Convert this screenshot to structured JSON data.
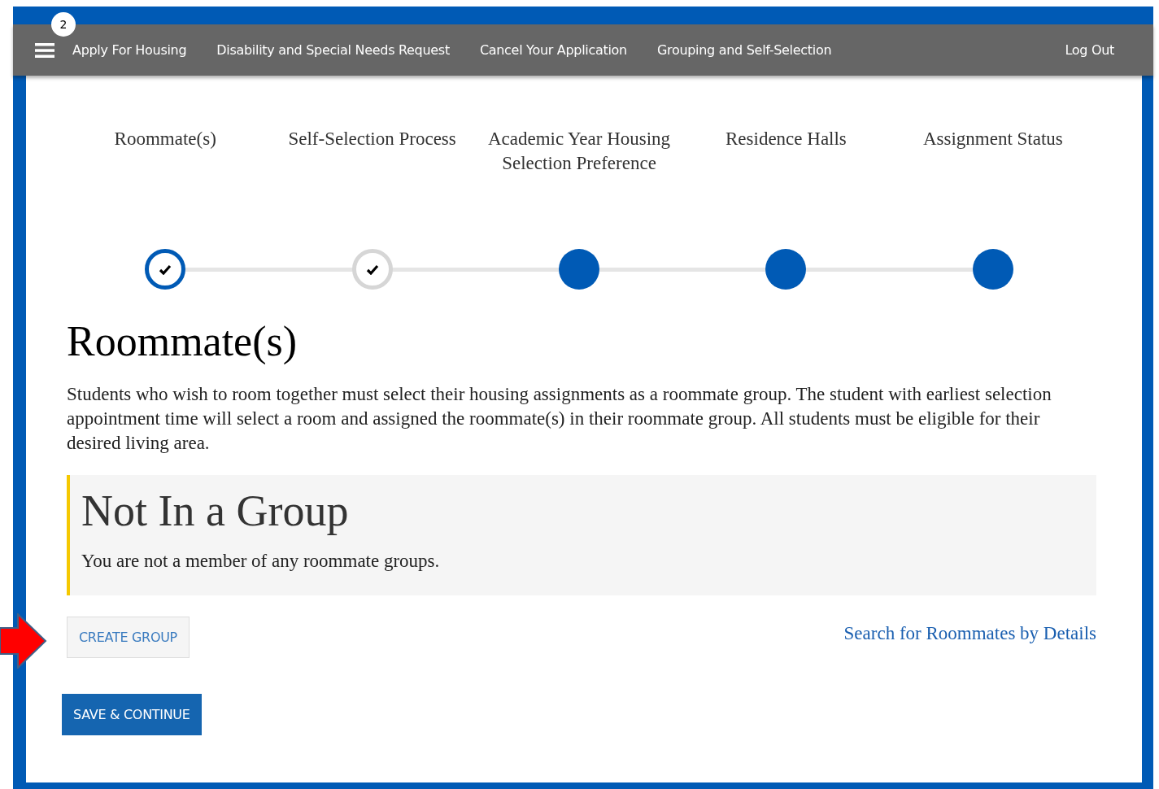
{
  "nav": {
    "badge": "2",
    "items": [
      "Apply For Housing",
      "Disability and Special Needs Request",
      "Cancel Your Application",
      "Grouping and Self-Selection"
    ],
    "logout": "Log Out"
  },
  "steps": [
    {
      "label": "Roommate(s)",
      "completed": true,
      "selected": true
    },
    {
      "label": "Self-Selection Process",
      "completed": true,
      "selected": false
    },
    {
      "label": "Academic Year Housing Selection Preference",
      "completed": false,
      "selected": false
    },
    {
      "label": "Residence Halls",
      "completed": false,
      "selected": false
    },
    {
      "label": "Assignment Status",
      "completed": false,
      "selected": false
    }
  ],
  "heading": "Roommate(s)",
  "intro": "Students who wish to room together must select their housing assignments as a roommate group. The student with earliest selection appointment time will select a room and assigned the roommate(s) in their roommate group. All students must be eligible for their desired living area.",
  "notice": {
    "title": "Not In a Group",
    "text": "You are not a member of any roommate groups."
  },
  "create_button": "CREATE GROUP",
  "search_link": "Search for Roommates by Details",
  "save_button": "SAVE & CONTINUE"
}
